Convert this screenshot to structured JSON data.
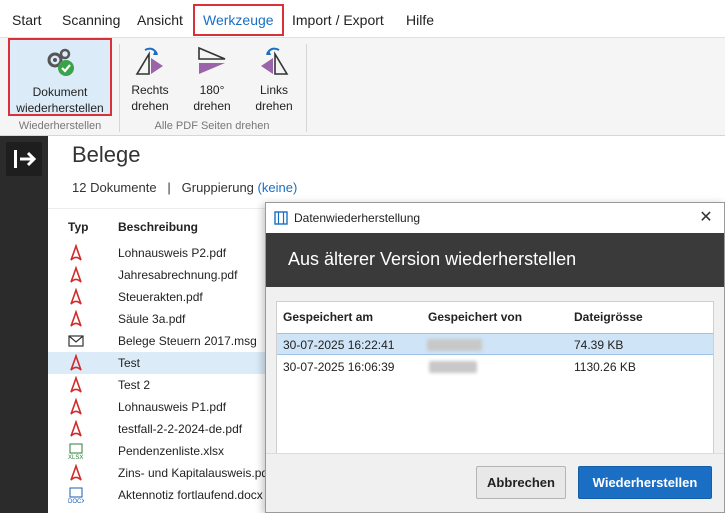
{
  "menu": {
    "start": "Start",
    "scanning": "Scanning",
    "ansicht": "Ansicht",
    "werkzeuge": "Werkzeuge",
    "import_export": "Import / Export",
    "hilfe": "Hilfe"
  },
  "ribbon": {
    "restore": {
      "line1": "Dokument",
      "line2": "wiederherstellen"
    },
    "restore_group": "Wiederherstellen",
    "rotate_right": {
      "line1": "Rechts",
      "line2": "drehen"
    },
    "rotate_180": {
      "line1": "180°",
      "line2": "drehen"
    },
    "rotate_left": {
      "line1": "Links",
      "line2": "drehen"
    },
    "rotate_group": "Alle PDF Seiten drehen"
  },
  "document": {
    "title": "Belege",
    "count": "12 Dokumente",
    "separator": "|",
    "grouping_label": "Gruppierung",
    "grouping_value": "(keine)"
  },
  "list": {
    "col_type": "Typ",
    "col_desc": "Beschreibung",
    "rows": [
      {
        "type": "pdf",
        "desc": "Lohnausweis P2.pdf"
      },
      {
        "type": "pdf",
        "desc": "Jahresabrechnung.pdf"
      },
      {
        "type": "pdf",
        "desc": "Steuerakten.pdf"
      },
      {
        "type": "pdf",
        "desc": "Säule 3a.pdf"
      },
      {
        "type": "msg",
        "desc": "Belege Steuern 2017.msg"
      },
      {
        "type": "pdf",
        "desc": "Test"
      },
      {
        "type": "pdf",
        "desc": "Test 2"
      },
      {
        "type": "pdf",
        "desc": "Lohnausweis P1.pdf"
      },
      {
        "type": "pdf",
        "desc": "testfall-2-2-2024-de.pdf"
      },
      {
        "type": "xlsx",
        "desc": "Pendenzenliste.xlsx"
      },
      {
        "type": "pdf",
        "desc": "Zins- und Kapitalausweis.pd"
      },
      {
        "type": "docx",
        "desc": "Aktennotiz fortlaufend.docx"
      }
    ]
  },
  "dialog": {
    "title": "Datenwiederherstellung",
    "header": "Aus älterer Version wiederherstellen",
    "col_saved_at": "Gespeichert am",
    "col_saved_by": "Gespeichert von",
    "col_size": "Dateigrösse",
    "rows": [
      {
        "saved_at": "30-07-2025 16:22:41",
        "size": "74.39 KB"
      },
      {
        "saved_at": "30-07-2025 16:06:39",
        "size": "1130.26 KB"
      }
    ],
    "cancel": "Abbrechen",
    "restore": "Wiederherstellen"
  },
  "colors": {
    "accent": "#1a6fc4",
    "highlight": "#d9303a",
    "pdf_red": "#d22a2a",
    "rotate_purple": "#8b4a9c"
  }
}
